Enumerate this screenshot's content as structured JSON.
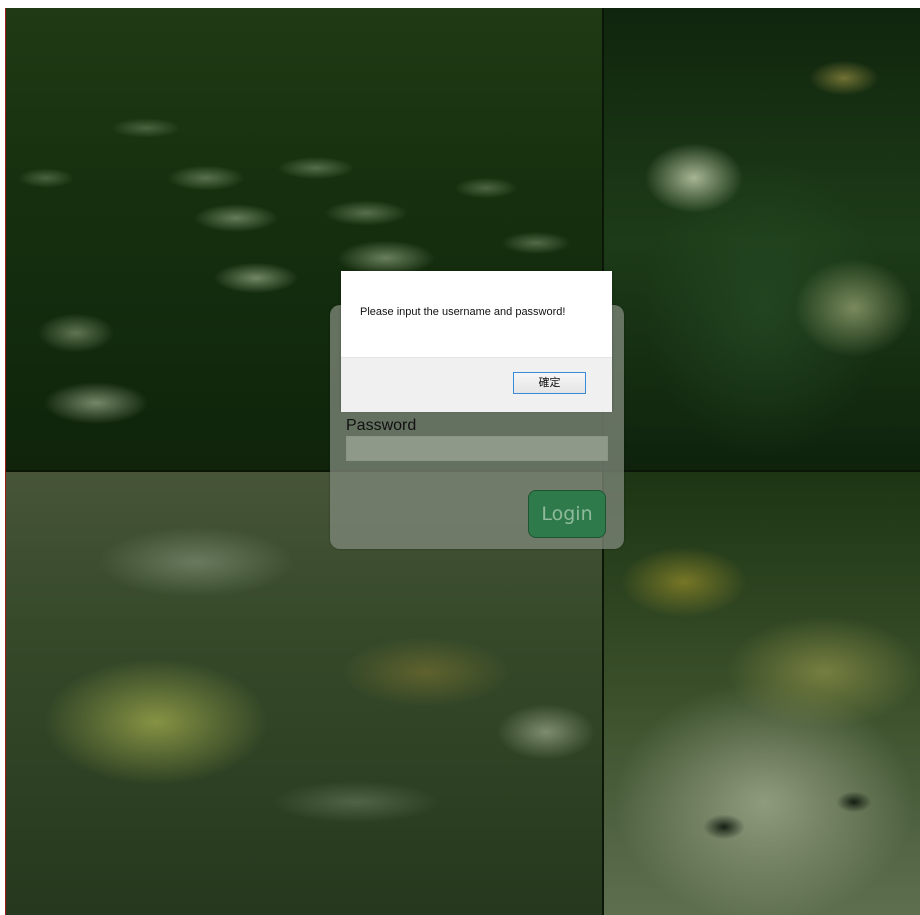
{
  "background": {
    "photos": [
      {
        "name": "salad-plates"
      },
      {
        "name": "poached-egg-dish"
      },
      {
        "name": "grain-salad-bowls"
      },
      {
        "name": "avocado-dish"
      }
    ]
  },
  "login": {
    "password_label": "Password",
    "password_value": "",
    "login_button": "Login"
  },
  "alert": {
    "message": "Please input the username and password!",
    "ok_button": "確定"
  },
  "colors": {
    "login_button": "#2f7a4b",
    "alert_ok_border": "#3c8ad6"
  }
}
